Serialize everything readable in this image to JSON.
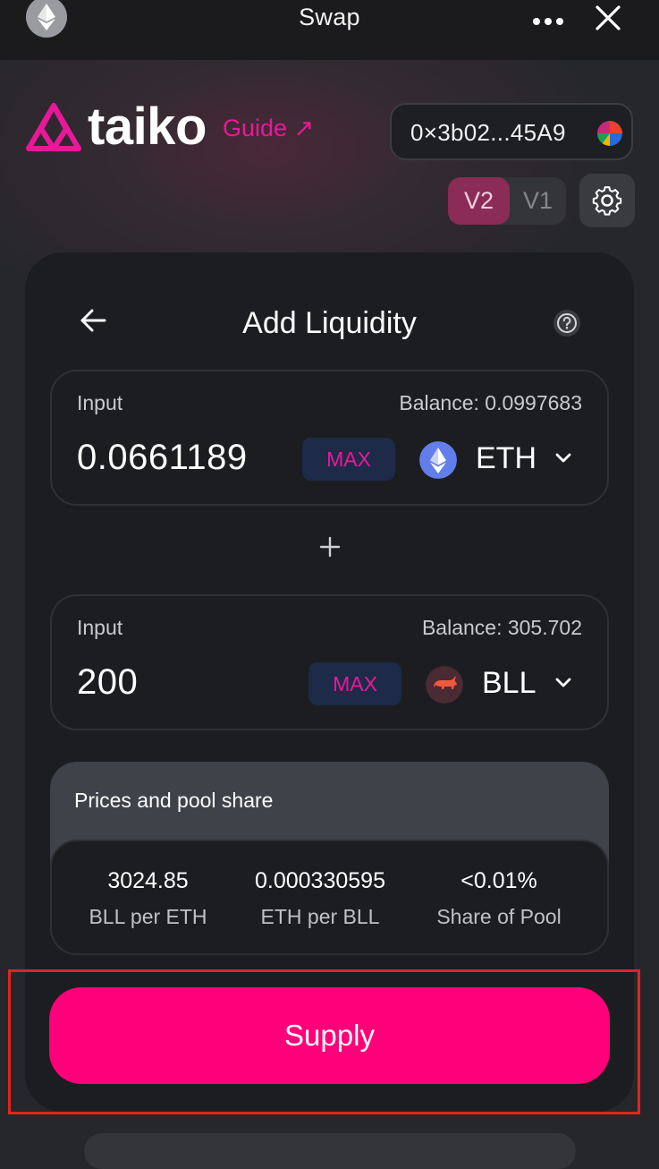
{
  "topbar": {
    "title": "Swap",
    "icons": {
      "left": "ethereum-icon",
      "more": "more-icon",
      "close": "close-icon"
    }
  },
  "header": {
    "brand": "taiko",
    "guide_label": "Guide ↗",
    "wallet_address": "0×3b02...45A9",
    "version_options": [
      "V2",
      "V1"
    ],
    "version_selected": "V2"
  },
  "card": {
    "title": "Add Liquidity",
    "inputs": [
      {
        "label": "Input",
        "balance": "Balance: 0.0997683",
        "amount": "0.0661189",
        "max_label": "MAX",
        "token": "ETH"
      },
      {
        "label": "Input",
        "balance": "Balance: 305.702",
        "amount": "200",
        "max_label": "MAX",
        "token": "BLL"
      }
    ],
    "prices": {
      "title": "Prices and pool share",
      "stats": [
        {
          "value": "3024.85",
          "label": "BLL per ETH"
        },
        {
          "value": "0.000330595",
          "label": "ETH per BLL"
        },
        {
          "value": "<0.01%",
          "label": "Share of Pool"
        }
      ]
    },
    "supply_label": "Supply"
  },
  "colors": {
    "accent": "#ff007a",
    "brand_pink": "#e81899",
    "background": "#26272b",
    "card": "#1c1d21",
    "highlight_box": "#e0241e"
  }
}
